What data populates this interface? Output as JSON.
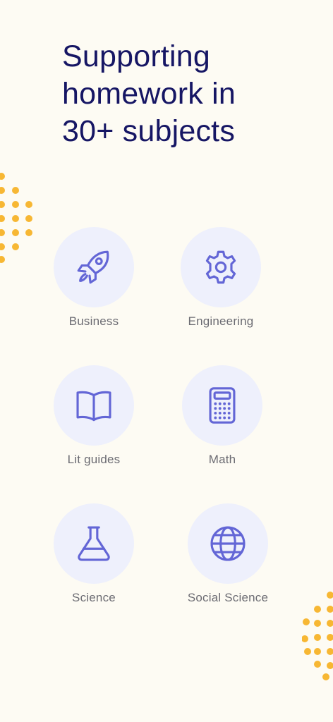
{
  "header": {
    "title_lines": [
      "Supporting",
      "homework in",
      "30+ subjects"
    ]
  },
  "subjects": [
    {
      "label": "Business",
      "icon": "rocket-icon"
    },
    {
      "label": "Engineering",
      "icon": "gear-icon"
    },
    {
      "label": "Lit guides",
      "icon": "book-icon"
    },
    {
      "label": "Math",
      "icon": "calculator-icon"
    },
    {
      "label": "Science",
      "icon": "flask-icon"
    },
    {
      "label": "Social Science",
      "icon": "globe-icon"
    }
  ],
  "colors": {
    "background": "#fdfbf3",
    "headline": "#161664",
    "icon": "#6366d6",
    "circle": "#eef0fc",
    "label": "#6b6b72",
    "dots": "#f7b733"
  }
}
